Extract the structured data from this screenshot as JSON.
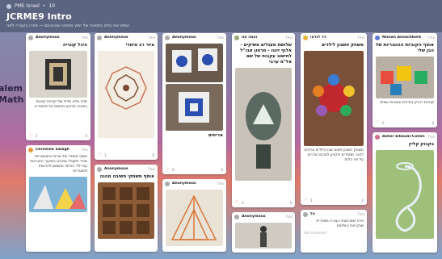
{
  "header": {
    "crumb_user": "PME Israel",
    "crumb_sep": "•",
    "crumb_count": "10",
    "title": "JCRME9 Intro",
    "subtitle": "שתפו את כולם בתמונה של חפץ מתמטי שאהבתם — ספרו בקצרה למה"
  },
  "side": {
    "words": [
      "alem",
      "Math"
    ]
  },
  "cards": [
    {
      "author": "Anonymous",
      "time": "7mo",
      "title": "היכל קובייה",
      "body": "מדף מלא מדפי של קוביות קטנות במבנה מרובע מבוסס על סימטריה",
      "likes": "2",
      "comments": "0"
    },
    {
      "author": "Anonymous",
      "time": "7mo",
      "title": "ציור רב מימדי",
      "body": "",
      "likes": "1",
      "comments": "0"
    },
    {
      "author": "Anonymous",
      "time": "7mo",
      "title": "אריחים",
      "body": "",
      "likes": "0",
      "comments": "0"
    },
    {
      "author": "נעמה ממ",
      "time": "7mo",
      "title": "שלושת מעגלים משיקים - אלוף זיגגו - מרטון אבו\"ל לחישוב עקבות של שם אל\"מ ערבי",
      "body": "",
      "likes": "0",
      "comments": "0"
    },
    {
      "author": "ניר לנדאו",
      "time": "7mo",
      "title": "משחק חשבון לילדים",
      "body": "משחק חשבון פשוט שבו הילדים צריכים לחבר מספרים ולהגיע לסכום הנדרש על פני הלוח",
      "likes": "1",
      "comments": "0"
    },
    {
      "author": "Nissan Avoachbork",
      "time": "7mo",
      "title": "אוסף הקוביות ההונגריות של הבן שלי",
      "body": "קוביות רוביק בגדלים ובצורות שונים",
      "likes": "0",
      "comments": "0"
    },
    {
      "author": "Christine Salagh",
      "time": "7mo",
      "title": "",
      "body": "אוסף מסודר של צורות גיאומטריות מנייר מקופל שהוכנו בשיעור האוריגמי עם ילדי הכיתה ומשמש להדגמת סימטריות",
      "likes": "0",
      "comments": "0"
    },
    {
      "author": "Anonymous",
      "time": "7mo",
      "title": "אוסף משחקי חשיבה מהנה",
      "body": "",
      "likes": "0",
      "comments": "0"
    },
    {
      "author": "Anonymous",
      "time": "7mo",
      "title": "",
      "body": "",
      "likes": "0",
      "comments": "0"
    },
    {
      "author": "טל",
      "time": "7mo",
      "title": "",
      "body": "פרח ששרטטתי בצורה מספרית שנקראת כשלמים",
      "likes": "0",
      "comments": "0"
    },
    {
      "author": "Anonymous",
      "time": "7mo",
      "title": "",
      "body": "",
      "likes": "0",
      "comments": "0"
    },
    {
      "author": "Asher Elbaum-Cohen",
      "time": "7mo",
      "title": "בקבוק קליין",
      "body": "",
      "likes": "0",
      "comments": "0"
    }
  ],
  "ui": {
    "add_comment": "Add comment",
    "more": "⋮",
    "heart": "♡"
  },
  "colors": {
    "topbar": "#5b6480",
    "card": "#ffffff"
  }
}
